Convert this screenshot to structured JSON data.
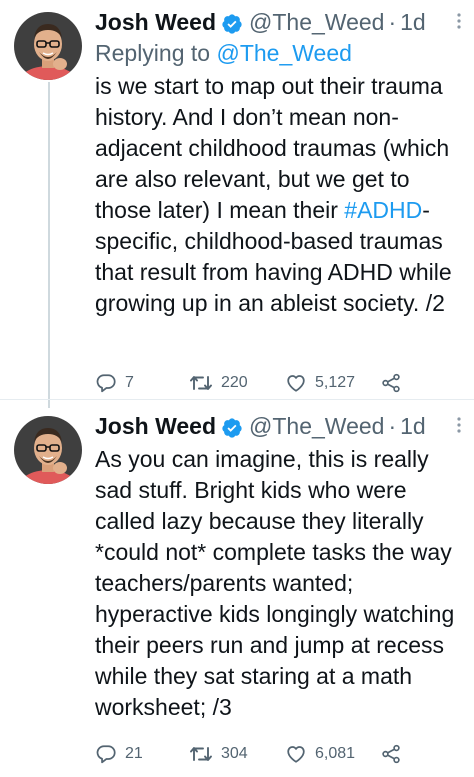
{
  "colors": {
    "link": "#1d9bf0",
    "secondary_text": "#536471",
    "primary_text": "#0f1419",
    "thread_line": "#cfd9de"
  },
  "tweets": [
    {
      "author": {
        "display_name": "Josh Weed",
        "verified_icon": "verified-badge-icon",
        "handle": "@The_Weed",
        "separator": "·",
        "time": "1d"
      },
      "reply_to": {
        "prefix": "Replying to",
        "mention": "@The_Weed"
      },
      "text": {
        "part1": "is we start to map out their trauma history. And I don’t mean non-adjacent childhood traumas (which are also relevant, but we get to those later) I mean their ",
        "hashtag": "#ADHD",
        "part2": "-specific, childhood-based traumas that result from having ADHD while growing up in an ableist society. /2"
      },
      "actions": {
        "replies": "7",
        "retweets": "220",
        "likes": "5,127"
      }
    },
    {
      "author": {
        "display_name": "Josh Weed",
        "verified_icon": "verified-badge-icon",
        "handle": "@The_Weed",
        "separator": "·",
        "time": "1d"
      },
      "text": {
        "body": "As you can imagine, this is really sad stuff. Bright kids who were called lazy because they literally *could not* complete tasks the way teachers/parents wanted; hyperactive kids longingly watching their peers run and jump at recess while they sat staring at a math worksheet; /3"
      },
      "actions": {
        "replies": "21",
        "retweets": "304",
        "likes": "6,081"
      }
    }
  ]
}
